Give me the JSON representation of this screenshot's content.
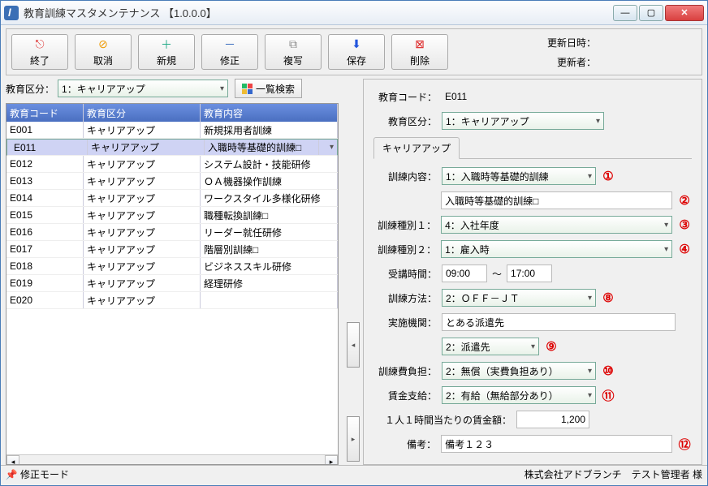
{
  "window": {
    "title": "教育訓練マスタメンテナンス 【1.0.0.0】"
  },
  "toolbar": {
    "exit": "終了",
    "cancel": "取消",
    "new": "新規",
    "edit": "修正",
    "copy": "複写",
    "save": "保存",
    "delete": "削除",
    "updated_at_label": "更新日時：",
    "updated_at": "",
    "updater_label": "更新者：",
    "updater": ""
  },
  "filter": {
    "label": "教育区分：",
    "value": "1：キャリアアップ",
    "list_search": "一覧検索"
  },
  "grid": {
    "cols": {
      "code": "教育コード",
      "kubun": "教育区分",
      "naiyou": "教育内容"
    },
    "rows": [
      {
        "code": "E001",
        "kubun": "キャリアアップ",
        "naiyou": "新規採用者訓練"
      },
      {
        "code": "E011",
        "kubun": "キャリアアップ",
        "naiyou": "入職時等基礎的訓練□"
      },
      {
        "code": "E012",
        "kubun": "キャリアアップ",
        "naiyou": "システム設計・技能研修"
      },
      {
        "code": "E013",
        "kubun": "キャリアアップ",
        "naiyou": "ＯＡ機器操作訓練"
      },
      {
        "code": "E014",
        "kubun": "キャリアアップ",
        "naiyou": "ワークスタイル多様化研修"
      },
      {
        "code": "E015",
        "kubun": "キャリアアップ",
        "naiyou": "職種転換訓練□"
      },
      {
        "code": "E016",
        "kubun": "キャリアアップ",
        "naiyou": "リーダー就任研修"
      },
      {
        "code": "E017",
        "kubun": "キャリアアップ",
        "naiyou": "階層別訓練□"
      },
      {
        "code": "E018",
        "kubun": "キャリアアップ",
        "naiyou": "ビジネススキル研修"
      },
      {
        "code": "E019",
        "kubun": "キャリアアップ",
        "naiyou": "経理研修"
      },
      {
        "code": "E020",
        "kubun": "キャリアアップ",
        "naiyou": ""
      }
    ],
    "selected_index": 1
  },
  "form": {
    "code_label": "教育コード：",
    "code": "E011",
    "kubun_label": "教育区分：",
    "kubun": "1：キャリアアップ",
    "tab_label": "キャリアアップ",
    "naiyou_label": "訓練内容：",
    "naiyou_sel": "1：入職時等基礎的訓練",
    "naiyou_txt": "入職時等基礎的訓練□",
    "type1_label": "訓練種別１：",
    "type1": "4：入社年度",
    "type2_label": "訓練種別２：",
    "type2": "1：雇入時",
    "time_label": "受講時間：",
    "time_from": "09:00",
    "time_sep": "～",
    "time_to": "17:00",
    "method_label": "訓練方法：",
    "method": "2：ＯＦＦ－ＪＴ",
    "org_label": "実施機関：",
    "org_txt": "とある派遣先",
    "org_sel": "2：派遣先",
    "cost_label": "訓練費負担：",
    "cost": "2：無償（実費負担あり）",
    "wage_label": "賃金支給：",
    "wage": "2：有給（無給部分あり）",
    "hourly_label": "１人１時間当たりの賃金額：",
    "hourly": "1,200",
    "remark_label": "備考：",
    "remark": "備考１２３"
  },
  "marks": {
    "m1": "①",
    "m2": "②",
    "m3": "③",
    "m4": "④",
    "m8": "⑧",
    "m9": "⑨",
    "m10": "⑩",
    "m11": "⑪",
    "m12": "⑫"
  },
  "status": {
    "mode": "修正モード",
    "company": "株式会社アドブランチ　テスト管理者 様"
  }
}
